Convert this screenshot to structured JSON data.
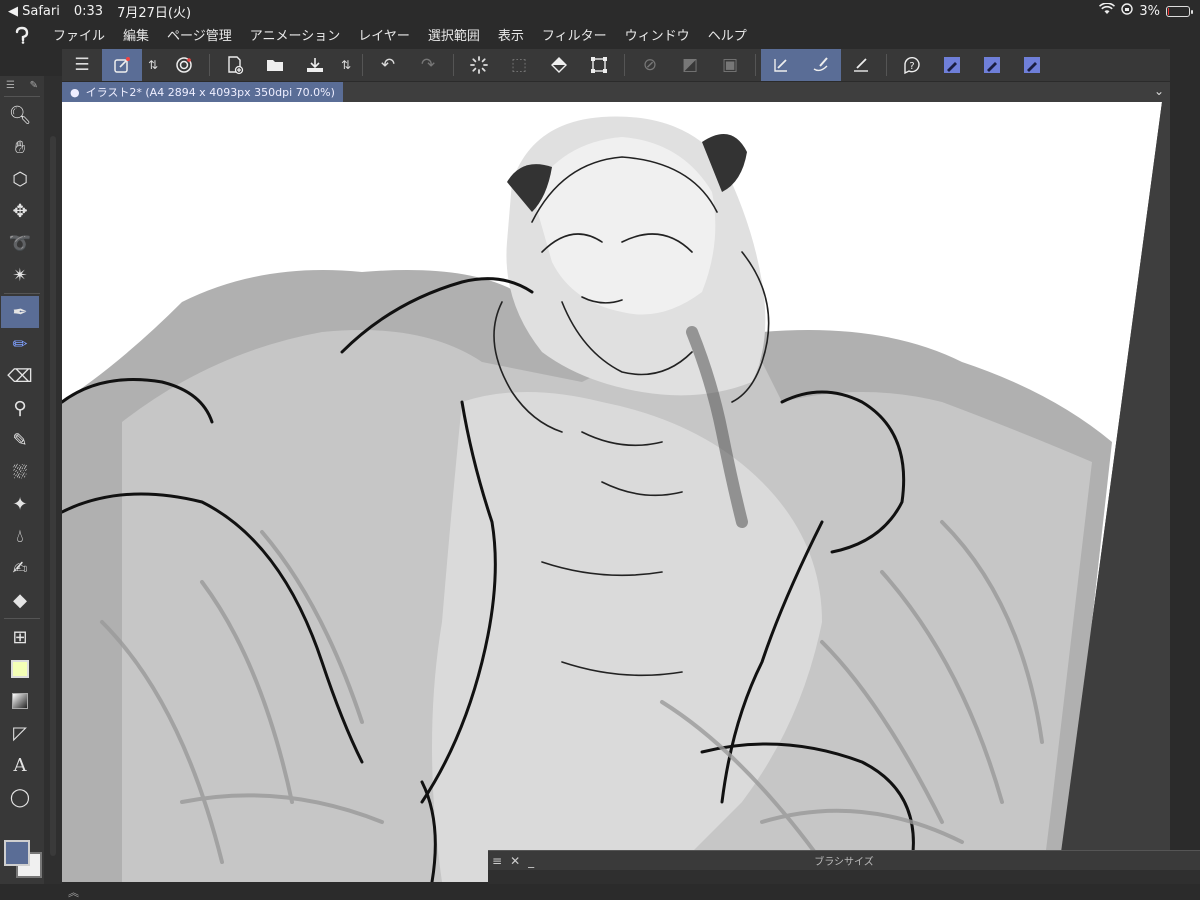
{
  "status_bar": {
    "back_app": "◀ Safari",
    "time": "0:33",
    "date": "7月27日(火)",
    "battery": "3%"
  },
  "menu": [
    "ファイル",
    "編集",
    "ページ管理",
    "アニメーション",
    "レイヤー",
    "選択範囲",
    "表示",
    "フィルター",
    "ウィンドウ",
    "ヘルプ"
  ],
  "document_tab": {
    "label": "イラスト2* (A4 2894 x 4093px 350dpi 70.0%)"
  },
  "brush_palette": {
    "title": "ブラシサイズ"
  },
  "colors": {
    "accent": "#5a6d96",
    "toolbar_bg": "#383838",
    "app_bg": "#2b2b2b",
    "main_color": "#5a6d96",
    "sub_color": "#f0f0f0",
    "lime_swatch": "#f4ffb6"
  },
  "command_bar_icons": [
    "menu-icon",
    "new-layer-icon",
    "chevron-updown-icon",
    "settings-spiral-icon",
    "new-page-icon",
    "open-folder-icon",
    "save-tray-icon",
    "chevron-updown-icon",
    "undo-icon",
    "redo-icon",
    "loading-icon",
    "transparent-select-icon",
    "fill-icon",
    "transform-icon",
    "deselect-icon",
    "invert-selection-icon",
    "select-all-icon",
    "ruler-snap-icon",
    "brush-snap-icon",
    "line-snap-icon",
    "help-icon",
    "pen-blue-1-icon",
    "pen-blue-2-icon",
    "pen-blue-3-icon"
  ],
  "tools": [
    "zoom-icon",
    "hand-icon",
    "object-select-icon",
    "move-icon",
    "lasso-icon",
    "auto-select-icon",
    "pen-icon",
    "pencil-icon",
    "eraser-icon",
    "eyedropper-icon",
    "decoration-icon",
    "airbrush-icon",
    "sparkle-icon",
    "blend-icon",
    "marker-icon",
    "fill-bucket-icon",
    "frame-icon",
    "color-swatch-icon",
    "gradient-icon",
    "ruler-icon",
    "text-icon",
    "balloon-icon"
  ]
}
